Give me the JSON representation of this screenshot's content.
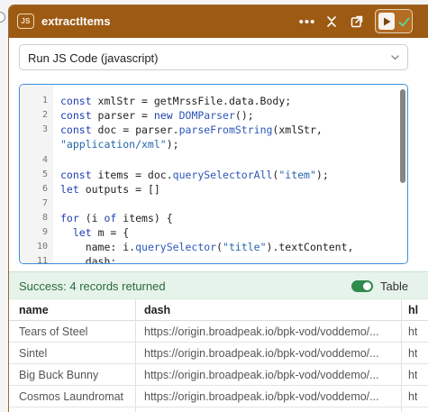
{
  "node": {
    "badge": "JS",
    "title": "extractItems",
    "menu_glyph": "•••",
    "icons": {
      "menu": "more-horizontal-icon",
      "collapse": "collapse-icon",
      "popout": "popout-icon",
      "run": "play-icon",
      "success": "check-icon"
    }
  },
  "select": {
    "value": "Run JS Code (javascript)",
    "icon": "chevron-down-icon"
  },
  "code": {
    "line_numbers": [
      "1",
      "2",
      "3",
      "",
      "4",
      "5",
      "6",
      "7",
      "8",
      "9",
      "10",
      "11"
    ]
  },
  "status": {
    "text": "Success: 4 records returned",
    "toggle_on": true,
    "toggle_label": "Table"
  },
  "table": {
    "columns": [
      "name",
      "dash",
      "hl"
    ],
    "rows": [
      [
        "Tears of Steel",
        "https://origin.broadpeak.io/bpk-vod/voddemo/...",
        "ht"
      ],
      [
        "Sintel",
        "https://origin.broadpeak.io/bpk-vod/voddemo/...",
        "ht"
      ],
      [
        "Big Buck Bunny",
        "https://origin.broadpeak.io/bpk-vod/voddemo/...",
        "ht"
      ],
      [
        "Cosmos Laundromat",
        "https://origin.broadpeak.io/bpk-vod/voddemo/...",
        "ht"
      ]
    ]
  },
  "colors": {
    "header": "#9c5a13",
    "success_bg": "#e6f3ea",
    "success_text": "#2a6a3a",
    "toggle": "#2f8a4e",
    "editor_focus": "#3c8dde"
  }
}
